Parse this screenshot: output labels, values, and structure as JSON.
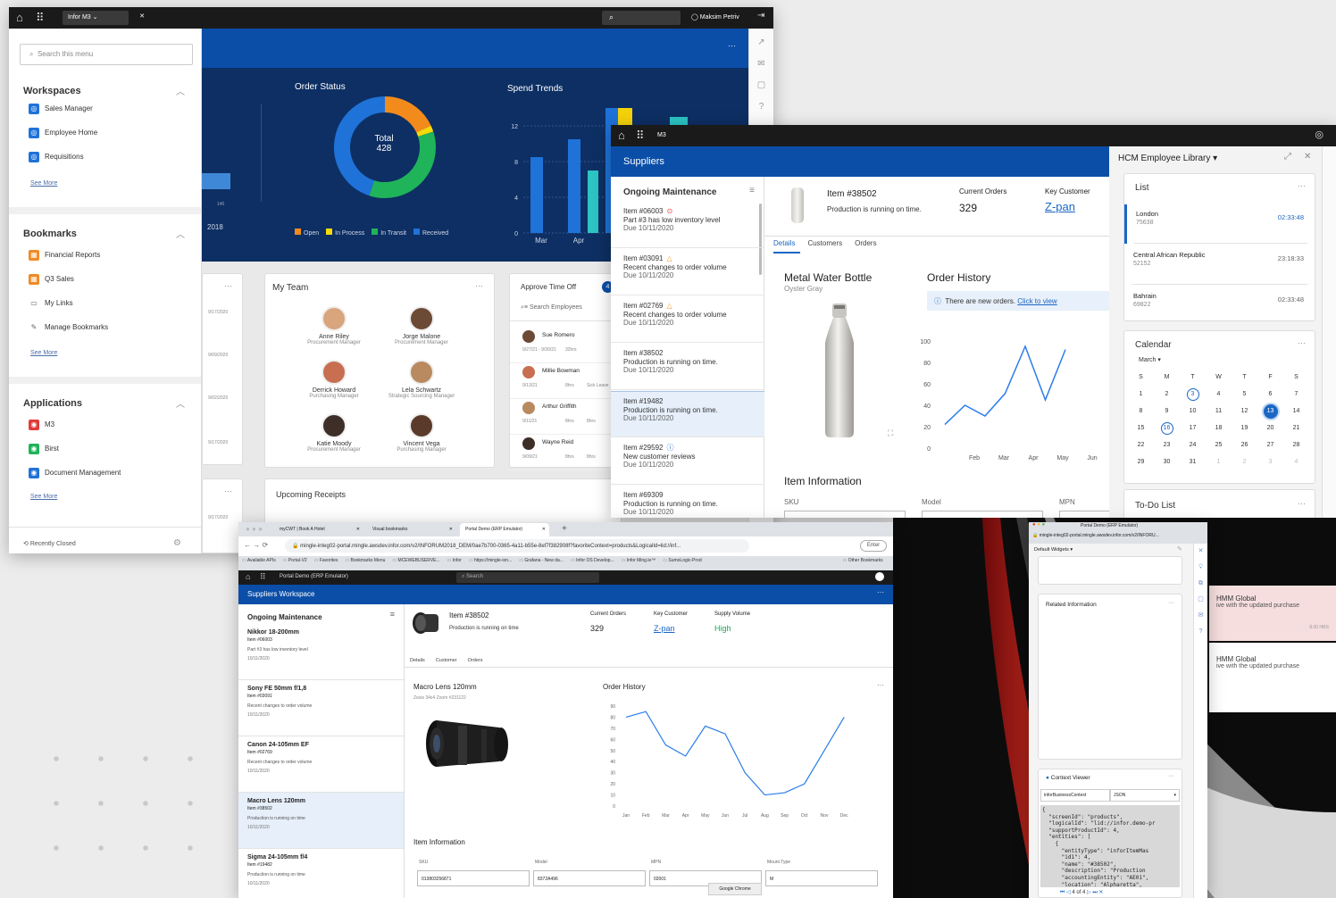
{
  "w1": {
    "app_tab": "Infor M3",
    "user": "Maksim Petriv",
    "search_placeholder": "Search this menu",
    "workspaces": {
      "title": "Workspaces",
      "items": [
        "Sales Manager",
        "Employee Home",
        "Requisitions"
      ],
      "see_more": "See More"
    },
    "bookmarks": {
      "title": "Bookmarks",
      "items": [
        "Financial Reports",
        "Q3 Sales",
        "My Links",
        "Manage Bookmarks"
      ],
      "see_more": "See More"
    },
    "applications": {
      "title": "Applications",
      "items": [
        "M3",
        "Birst",
        "Document Management"
      ],
      "see_more": "See More"
    },
    "recently_closed": "Recently Closed",
    "order_status": {
      "title": "Order Status",
      "total_label": "Total",
      "total_value": "428",
      "legend": [
        "Open",
        "In Process",
        "In Transit",
        "Received"
      ],
      "colors": [
        "#f28b1c",
        "#f5d90a",
        "#1fb35a",
        "#1f72d8"
      ],
      "segments": [
        0.18,
        0.02,
        0.35,
        0.45
      ]
    },
    "spend_trends": {
      "title": "Spend Trends",
      "yticks": [
        "12",
        "8",
        "4",
        "0"
      ],
      "months": [
        "Mar",
        "Apr",
        "Ma"
      ]
    },
    "left_chart": {
      "year": "2018",
      "tick": "140"
    },
    "dates": [
      "9/17/2020",
      "9/09/2020",
      "9/02/2020",
      "9/17/2020",
      "9/17/2020"
    ],
    "my_team": {
      "title": "My Team",
      "members": [
        {
          "name": "Anne Riley",
          "role": "Procurement Manager"
        },
        {
          "name": "Jorge Malone",
          "role": "Procurement Manager"
        },
        {
          "name": "Derrick Howard",
          "role": "Purchasing Manager"
        },
        {
          "name": "Lela Schwartz",
          "role": "Strategic Sourcing Manager"
        },
        {
          "name": "Katie Moody",
          "role": "Procurement Manager"
        },
        {
          "name": "Vincent Vega",
          "role": "Purchasing Manager"
        }
      ]
    },
    "approve": {
      "title": "Approve Time Off",
      "count": "4",
      "search": "Search Employees",
      "rows": [
        {
          "name": "Sue Romero",
          "date": "9/27/21 - 9/30/21",
          "hrs": "32hrs",
          "type": ""
        },
        {
          "name": "Millie Bowman",
          "date": "9/13/21",
          "hrs": "8hrs",
          "type": "Sick Leave"
        },
        {
          "name": "Arthur Griffith",
          "date": "9/11/21",
          "hrs": "8hrs",
          "type": "8hrs"
        },
        {
          "name": "Wayne Reid",
          "date": "9/09/21",
          "hrs": "8hrs",
          "type": "8hrs"
        }
      ]
    },
    "upcoming": "Upcoming Receipts",
    "more": "···"
  },
  "w2": {
    "app": "M3",
    "section": "Suppliers",
    "ongoing": "Ongoing Maintenance",
    "items": [
      {
        "id": "Item #06003",
        "desc": "Part #3 has low inventory level",
        "due": "Due 10/11/2020",
        "icon": "⊙"
      },
      {
        "id": "Item #03091",
        "desc": "Recent changes to order volume",
        "due": "Due 10/11/2020",
        "icon": "△"
      },
      {
        "id": "Item #02769",
        "desc": "Recent changes to order volume",
        "due": "Due 10/11/2020",
        "icon": "△"
      },
      {
        "id": "Item #38502",
        "desc": "Production is running on time.",
        "due": "Due 10/11/2020",
        "icon": ""
      },
      {
        "id": "Item #19482",
        "desc": "Production is running on time.",
        "due": "Due 10/11/2020",
        "icon": ""
      },
      {
        "id": "Item #29592",
        "desc": "New customer reviews",
        "due": "Due 10/11/2020",
        "icon": "ⓘ"
      },
      {
        "id": "Item #69309",
        "desc": "Production is running on time.",
        "due": "Due 10/11/2020",
        "icon": ""
      }
    ],
    "header": {
      "item": "Item #38502",
      "status": "Production is running on time.",
      "orders_label": "Current Orders",
      "orders": "329",
      "key_label": "Key Customer",
      "key": "Z-pan"
    },
    "tabs": [
      "Details",
      "Customers",
      "Orders"
    ],
    "product": "Metal Water Bottle",
    "variant": "Oyster Gray",
    "order_history": "Order History",
    "notice": "There are new orders.",
    "notice_link": "Click to view",
    "item_info": "Item Information",
    "fields": [
      "SKU",
      "Model",
      "MPN"
    ],
    "hcm": "HCM Employee Library",
    "list_title": "List",
    "clocks": [
      {
        "city": "London",
        "code": "75638",
        "time": "02:33:48"
      },
      {
        "city": "Central African Republic",
        "code": "52152",
        "time": "23:18:33"
      },
      {
        "city": "Bahrain",
        "code": "69822",
        "time": "02:33:48"
      }
    ],
    "calendar": {
      "title": "Calendar",
      "month": "March",
      "days": [
        "S",
        "M",
        "T",
        "W",
        "T",
        "F",
        "S"
      ],
      "weeks": [
        [
          "1",
          "2",
          "3",
          "4",
          "5",
          "6",
          "7"
        ],
        [
          "8",
          "9",
          "10",
          "11",
          "12",
          "13",
          "14"
        ],
        [
          "15",
          "16",
          "17",
          "18",
          "19",
          "20",
          "21"
        ],
        [
          "22",
          "23",
          "24",
          "25",
          "26",
          "27",
          "28"
        ],
        [
          "29",
          "30",
          "31",
          "1",
          "2",
          "3",
          "4"
        ]
      ]
    },
    "todo": "To-Do List",
    "todo_items": [
      {
        "title": "HMM Global",
        "desc": "ive with the updated purchase",
        "time": "8.00 HRS"
      },
      {
        "title": "HMM Global",
        "desc": "ive with the updated purchase"
      }
    ]
  },
  "w3": {
    "tabs": [
      "myCWT | Book A Hotel",
      "Visual bookmarks",
      "Portal Demo (ERP Emulator)"
    ],
    "url": "mingle-integ02-portal.mingle.awsdev.infor.com/v2/INFORUM2018_DEM/0ae7b700-0365-4a11-b55e-8ef7f382908f?favoriteContext=products&LogicalId=lid://inf...",
    "enter": "Enter",
    "bookmarks": [
      "Available APIs",
      "Portal-V2",
      "Favorites",
      "Bookmarks Menu",
      "MCEWEBUSERVE...",
      "Infor",
      "https://mingle-ion...",
      "Grafana - New da...",
      "Infor OS Develop...",
      "Infor Ming.le™",
      "SumoLogic-Prod",
      "Other Bookmarks"
    ],
    "app": "Portal Demo (ERP Emulator)",
    "search": "Search",
    "workspace": "Suppliers Workspace",
    "ongoing": "Ongoing Maintenance",
    "items": [
      {
        "name": "Nikkor 18-200mm",
        "id": "Item #06003",
        "desc": "Part #3 has low inventory level",
        "date": "10/11/2020"
      },
      {
        "name": "Sony FE 50mm f/1,8",
        "id": "Item #03091",
        "desc": "Recent changes to order volume",
        "date": "10/11/2020"
      },
      {
        "name": "Canon 24-105mm EF",
        "id": "Item #02769",
        "desc": "Recent changes to order volume",
        "date": "10/11/2020"
      },
      {
        "name": "Macro Lens 120mm",
        "id": "Item #38502",
        "desc": "Production is running on time",
        "date": "10/11/2020"
      },
      {
        "name": "Sigma 24-105mm f/4",
        "id": "Item #19482",
        "desc": "Production is running on time",
        "date": "10/11/2020"
      }
    ],
    "header": {
      "item": "Item #38502",
      "status": "Production is running on time",
      "orders_label": "Current Orders",
      "orders": "329",
      "key_label": "Key Customer",
      "key": "Z-pan",
      "supply_label": "Supply Volume",
      "supply": "High"
    },
    "tabs2": [
      "Details",
      "Customer",
      "Orders"
    ],
    "product": "Macro Lens 120mm",
    "variant": "Zeiss 34x4 Zoom #231122",
    "order_history": "Order History",
    "item_info": "Item Information",
    "fields": [
      {
        "label": "SKU",
        "value": "013803256871"
      },
      {
        "label": "Model",
        "value": "8372A496"
      },
      {
        "label": "MPN",
        "value": "02001"
      },
      {
        "label": "Mount Type",
        "value": "M"
      }
    ],
    "tooltip": "Google Chrome"
  },
  "w4": {
    "title": "Portal Demo (ERP Emulator)",
    "url": "mingle-integ02-portal.mingle.awsdev.infor.com/v2/INFORU...",
    "widgets": "Default Widgets",
    "related": "Related Information",
    "context": "Context Viewer",
    "select1": "inforBusinessContext",
    "select2": "JSON",
    "json": "{\n  \"screenId\": \"products\",\n  \"logicalId\": \"lid://infor.demo-pr\n  \"supportProductId\": 4,\n  \"entities\": [\n    {\n      \"entityType\": \"inforItemMas\n      \"id1\": 4,\n      \"name\": \"#38502\",\n      \"description\": \"Production\n      \"accountingEntity\": \"AE01\",\n      \"location\": \"Alpharetta\",",
    "pager": "4 of 4"
  },
  "chart_data": [
    {
      "type": "bar",
      "title": "Spend Trends",
      "categories": [
        "Mar",
        "Apr",
        "Ma"
      ],
      "yticks": [
        0,
        4,
        8,
        12
      ],
      "series": [
        {
          "values": [
            8.5,
            10.5,
            14
          ]
        },
        {
          "values": [
            7,
            13
          ]
        }
      ]
    },
    {
      "type": "line",
      "title": "Order History",
      "x": [
        "",
        "Feb",
        "Mar",
        "Apr",
        "May",
        "Jun"
      ],
      "values": [
        22,
        40,
        30,
        51,
        95,
        45,
        92
      ],
      "ylim": [
        0,
        100
      ],
      "yticks": [
        0,
        20,
        40,
        60,
        80,
        100
      ]
    },
    {
      "type": "line",
      "title": "Order History",
      "x": [
        "Jan",
        "Feb",
        "Mar",
        "Apr",
        "May",
        "Jun",
        "Jul",
        "Aug",
        "Sep",
        "Oct",
        "Nov",
        "Dec"
      ],
      "values": [
        80,
        85,
        55,
        45,
        72,
        65,
        30,
        10,
        12,
        20,
        50,
        80
      ],
      "ylim": [
        0,
        90
      ],
      "yticks": [
        0,
        10,
        20,
        30,
        40,
        50,
        60,
        70,
        80,
        90
      ]
    }
  ]
}
